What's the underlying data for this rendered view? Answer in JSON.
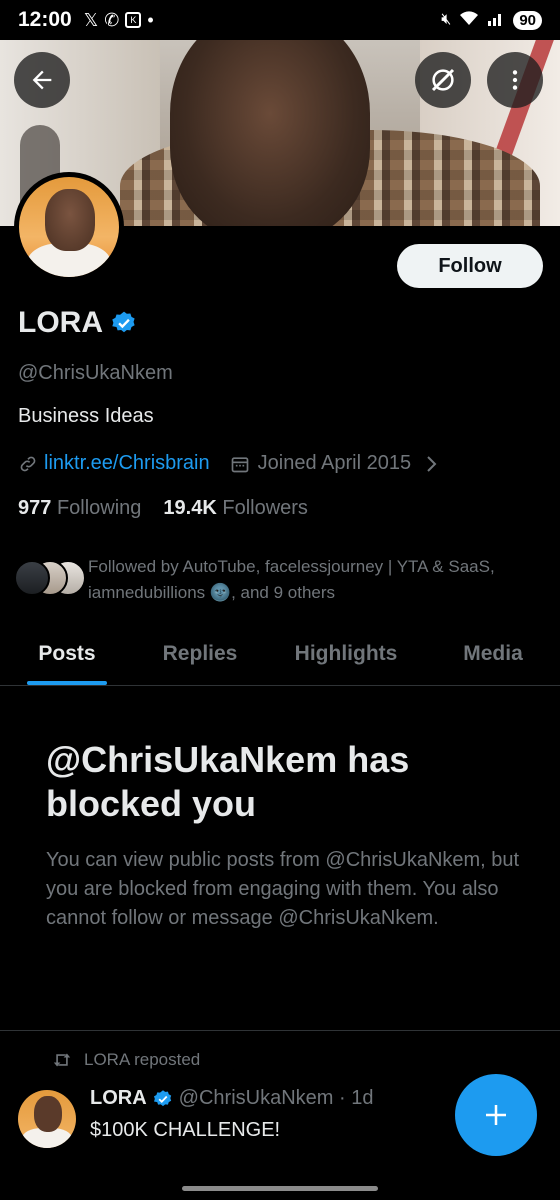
{
  "status_bar": {
    "time": "12:00",
    "battery": "90"
  },
  "profile": {
    "name": "LORA",
    "handle": "@ChrisUkaNkem",
    "bio": "Business Ideas",
    "link": "linktr.ee/Chrisbrain",
    "joined": "Joined April 2015",
    "following_count": "977",
    "following_label": "Following",
    "followers_count": "19.4K",
    "followers_label": "Followers",
    "followed_by": "Followed by AutoTube, facelessjourney | YTA & SaaS, iamnedubillions 🌚, and 9 others",
    "follow_label": "Follow"
  },
  "tabs": [
    {
      "label": "Posts",
      "active": true
    },
    {
      "label": "Replies",
      "active": false
    },
    {
      "label": "Highlights",
      "active": false
    },
    {
      "label": "Media",
      "active": false
    }
  ],
  "blocked": {
    "title": "@ChrisUkaNkem has blocked you",
    "description": "You can view public posts from @ChrisUkaNkem, but you are blocked from engaging with them. You also cannot follow or message @ChrisUkaNkem."
  },
  "post": {
    "repost_label": "LORA reposted",
    "author_name": "LORA",
    "author_handle_time": "@ChrisUkaNkem · 1d",
    "text": "$100K CHALLENGE!"
  },
  "colors": {
    "accent": "#1d9bf0",
    "background": "#000000",
    "secondary_text": "#71767b",
    "primary_text": "#e7e9ea"
  }
}
